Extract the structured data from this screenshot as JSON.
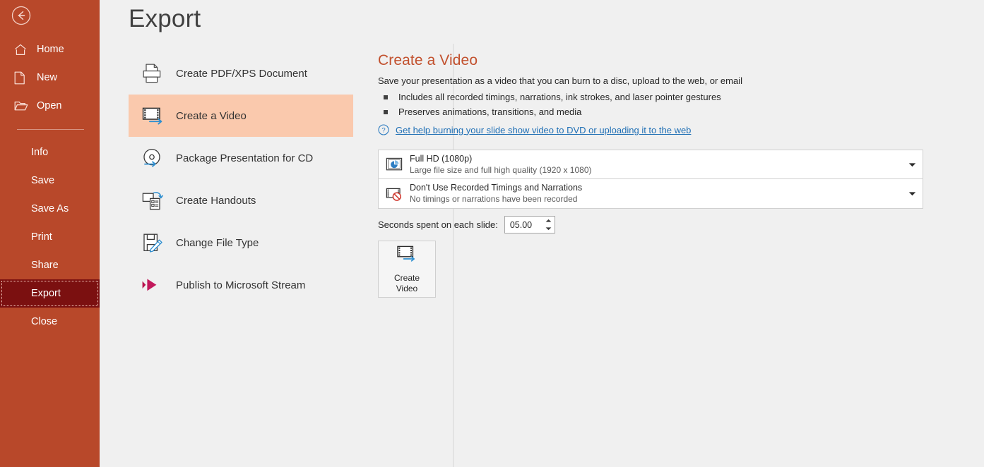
{
  "sidebar": {
    "back_button": "back-arrow",
    "top_items": [
      {
        "label": "Home",
        "icon": "home-icon"
      },
      {
        "label": "New",
        "icon": "new-document-icon"
      },
      {
        "label": "Open",
        "icon": "open-folder-icon"
      }
    ],
    "items": [
      {
        "label": "Info"
      },
      {
        "label": "Save"
      },
      {
        "label": "Save As"
      },
      {
        "label": "Print"
      },
      {
        "label": "Share"
      },
      {
        "label": "Export"
      },
      {
        "label": "Close"
      }
    ],
    "selected": "Export",
    "bg_color": "#b8482a",
    "selected_bg_color": "#7b1010"
  },
  "page": {
    "title": "Export"
  },
  "export_options": [
    {
      "label": "Create PDF/XPS Document",
      "icon": "pdf-xps-icon"
    },
    {
      "label": "Create a Video",
      "icon": "create-video-icon"
    },
    {
      "label": "Package Presentation for CD",
      "icon": "package-cd-icon"
    },
    {
      "label": "Create Handouts",
      "icon": "create-handouts-icon"
    },
    {
      "label": "Change File Type",
      "icon": "change-file-type-icon"
    },
    {
      "label": "Publish to Microsoft Stream",
      "icon": "microsoft-stream-icon"
    }
  ],
  "export_selected": "Create a Video",
  "detail": {
    "title": "Create a Video",
    "title_color": "#c2512e",
    "description": "Save your presentation as a video that you can burn to a disc, upload to the web, or email",
    "bullets": [
      "Includes all recorded timings, narrations, ink strokes, and laser pointer gestures",
      "Preserves animations, transitions, and media"
    ],
    "help_link": "Get help burning your slide show video to DVD or uploading it to the web",
    "help_link_color": "#1f6fb5",
    "quality_dropdown": {
      "title": "Full HD (1080p)",
      "subtitle": "Large file size and full high quality (1920 x 1080)",
      "icon": "monitor-quality-icon"
    },
    "timings_dropdown": {
      "title": "Don't Use Recorded Timings and Narrations",
      "subtitle": "No timings or narrations have been recorded",
      "icon": "no-timings-icon"
    },
    "seconds_label": "Seconds spent on each slide:",
    "seconds_value": "05.00",
    "create_video_button": {
      "line1": "Create",
      "line2": "Video",
      "icon": "create-video-icon"
    }
  }
}
